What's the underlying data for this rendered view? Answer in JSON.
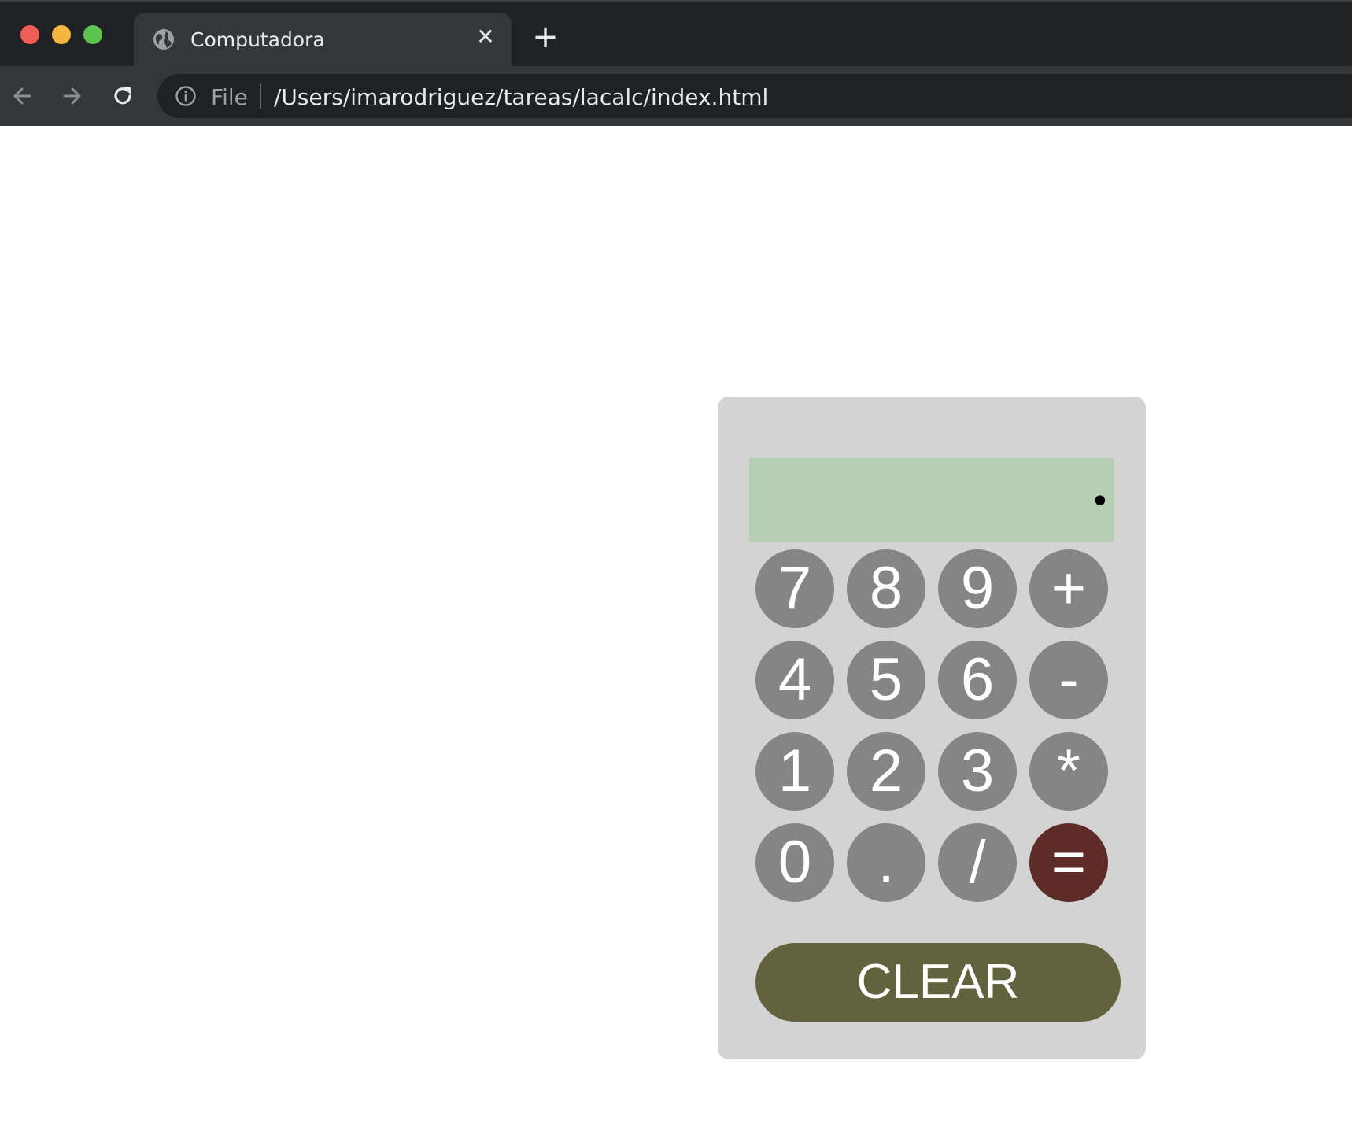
{
  "browser": {
    "tab": {
      "title": "Computadora",
      "close_label": "✕"
    },
    "new_tab_label": "+",
    "address_bar": {
      "scheme_label": "File",
      "url": "/Users/imarodriguez/tareas/lacalc/index.html"
    }
  },
  "calculator": {
    "display_value": "•",
    "keys": {
      "k7": "7",
      "k8": "8",
      "k9": "9",
      "plus": "+",
      "k4": "4",
      "k5": "5",
      "k6": "6",
      "minus": "-",
      "k1": "1",
      "k2": "2",
      "k3": "3",
      "multiply": "*",
      "k0": "0",
      "dot": ".",
      "divide": "/",
      "equals": "="
    },
    "clear_label": "CLEAR",
    "colors": {
      "body": "#d3d3d3",
      "display": "#b5cdb3",
      "key": "#858585",
      "equals": "#5e2b28",
      "clear": "#62633e"
    }
  }
}
